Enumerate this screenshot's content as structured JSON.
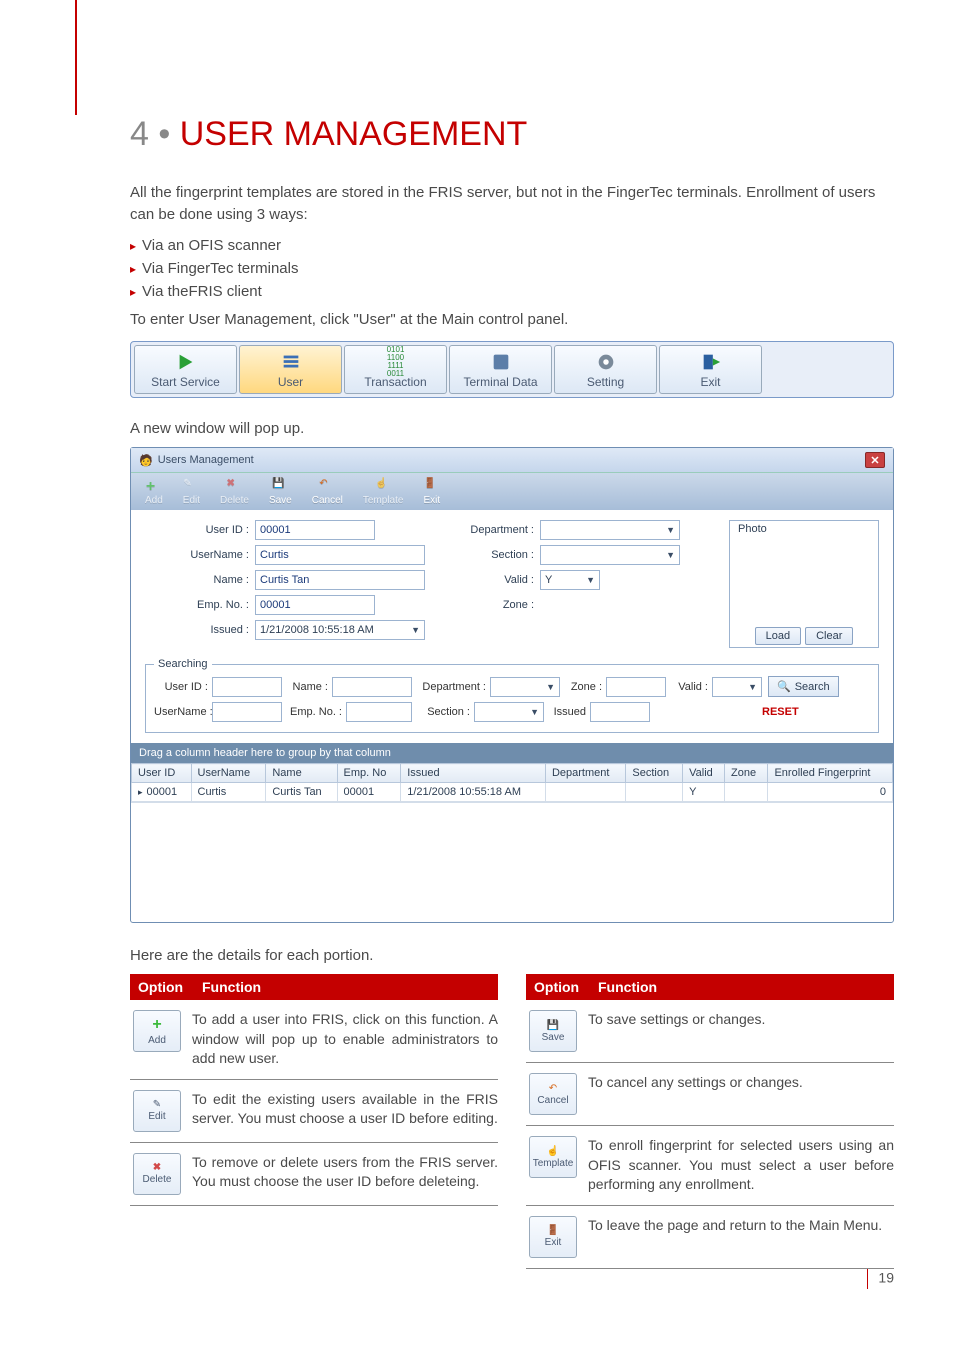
{
  "heading": {
    "prefix": "4 •",
    "title": "USER MANAGEMENT"
  },
  "intro": "All the fingerprint templates are stored in the FRIS server, but not in the FingerTec terminals. Enrollment of users can be done using 3 ways:",
  "bullets": [
    "Via an OFIS scanner",
    "Via FingerTec terminals",
    "Via theFRIS client"
  ],
  "instruction": "To enter User Management, click \"User\" at the Main control panel.",
  "toolbar": {
    "items": [
      "Start Service",
      "User",
      "Transaction",
      "Terminal Data",
      "Setting",
      "Exit"
    ]
  },
  "popup_label": "A new window will pop up.",
  "window": {
    "title": "Users Management",
    "toolbar": [
      "Add",
      "Edit",
      "Delete",
      "Save",
      "Cancel",
      "Template",
      "Exit"
    ],
    "form": {
      "userid_lbl": "User ID :",
      "userid_val": "00001",
      "username_lbl": "UserName :",
      "username_val": "Curtis",
      "name_lbl": "Name :",
      "name_val": "Curtis Tan",
      "empno_lbl": "Emp. No. :",
      "empno_val": "00001",
      "issued_lbl": "Issued :",
      "issued_val": "1/21/2008 10:55:18 AM",
      "dept_lbl": "Department :",
      "section_lbl": "Section :",
      "valid_lbl": "Valid :",
      "valid_val": "Y",
      "zone_lbl": "Zone :",
      "photo_lbl": "Photo",
      "load_btn": "Load",
      "clear_btn": "Clear"
    },
    "search": {
      "legend": "Searching",
      "userid_lbl": "User ID :",
      "name_lbl": "Name :",
      "dept_lbl": "Department :",
      "zone_lbl": "Zone :",
      "valid_lbl": "Valid :",
      "username_lbl": "UserName :",
      "empno_lbl": "Emp. No. :",
      "section_lbl": "Section :",
      "issued_lbl": "Issued",
      "search_btn": "Search",
      "reset": "RESET"
    },
    "group_bar": "Drag a column header here to group by that column",
    "grid": {
      "cols": [
        "User ID",
        "UserName",
        "Name",
        "Emp. No",
        "Issued",
        "Department",
        "Section",
        "Valid",
        "Zone",
        "Enrolled Fingerprint"
      ],
      "row": [
        "00001",
        "Curtis",
        "Curtis Tan",
        "00001",
        "1/21/2008 10:55:18 AM",
        "",
        "",
        "Y",
        "",
        "0"
      ]
    }
  },
  "details_label": "Here are the details for each portion.",
  "opt_head": {
    "c1": "Option",
    "c2": "Function"
  },
  "left_options": [
    {
      "icon": "Add",
      "desc": "To add a user into FRIS, click on this function. A window will pop up to enable administrators to add new user."
    },
    {
      "icon": "Edit",
      "desc": "To edit the existing users available in the FRIS server. You must choose a user ID before editing."
    },
    {
      "icon": "Delete",
      "desc": "To remove or delete users from the FRIS server. You must choose the user ID before deleteing."
    }
  ],
  "right_options": [
    {
      "icon": "Save",
      "desc": "To save settings or changes."
    },
    {
      "icon": "Cancel",
      "desc": "To cancel any settings or changes."
    },
    {
      "icon": "Template",
      "desc": "To enroll fingerprint for selected users using an OFIS scanner. You must select a user before performing any enrollment."
    },
    {
      "icon": "Exit",
      "desc": "To leave the page and return to the Main Menu."
    }
  ],
  "page_num": "19"
}
